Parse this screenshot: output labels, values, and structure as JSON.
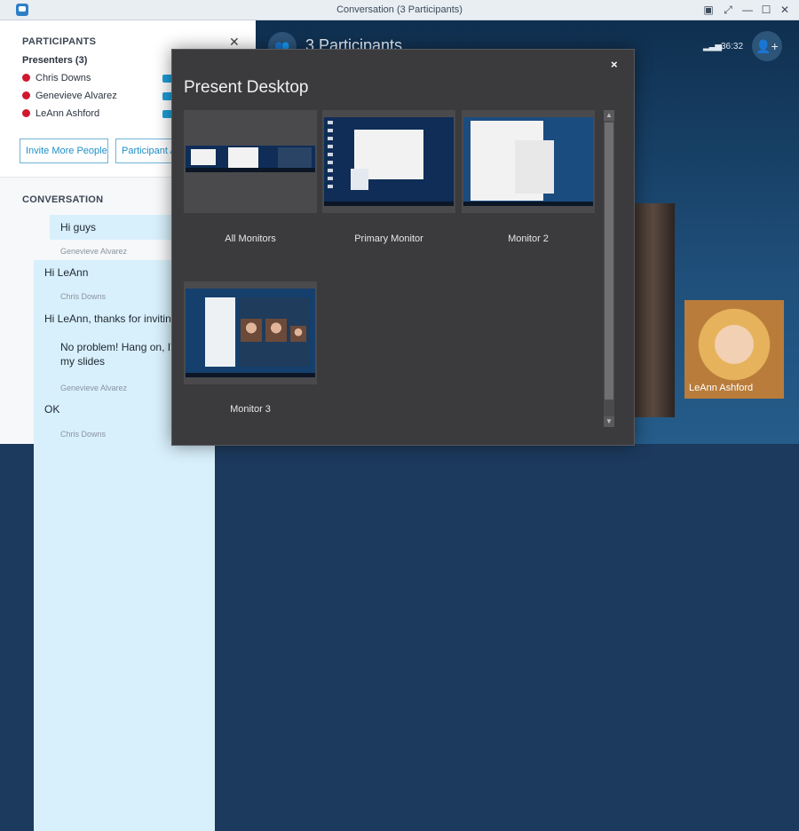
{
  "window": {
    "title": "Conversation (3 Participants)"
  },
  "participants_panel": {
    "heading": "PARTICIPANTS",
    "presenters_label": "Presenters (3)",
    "people": [
      "Chris Downs",
      "Genevieve Alvarez",
      "LeAnn Ashford"
    ],
    "invite_button": "Invite More People",
    "participant_actions_button": "Participant A"
  },
  "conversation": {
    "heading": "CONVERSATION",
    "messages": [
      {
        "text": "Hi guys"
      },
      {
        "author": "Genevieve Alvarez"
      },
      {
        "text": "Hi LeAnn"
      },
      {
        "author": "Chris Downs"
      },
      {
        "text": "Hi LeAnn, thanks for inviting"
      },
      {
        "text": "No problem! Hang on, I'l my slides"
      },
      {
        "author": "Genevieve Alvarez"
      },
      {
        "text": "OK"
      },
      {
        "author": "Chris Downs"
      }
    ]
  },
  "call": {
    "participants_label": "3 Participants",
    "duration": "36:32",
    "video_name": "LeAnn Ashford"
  },
  "present_dialog": {
    "title": "Present Desktop",
    "close": "×",
    "options": [
      "All Monitors",
      "Primary Monitor",
      "Monitor 2",
      "Monitor 3"
    ]
  },
  "icons": {
    "app": "chat-icon",
    "group": "group-icon",
    "add_person": "add-person-icon",
    "signal": "signal-icon"
  }
}
